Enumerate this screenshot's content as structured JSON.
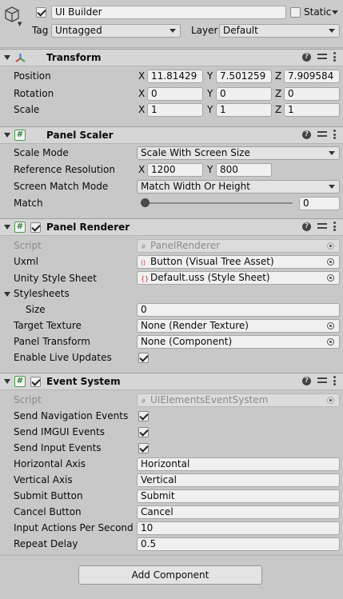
{
  "header": {
    "name": "UI Builder",
    "static_label": "Static",
    "tag_label": "Tag",
    "tag_value": "Untagged",
    "layer_label": "Layer",
    "layer_value": "Default"
  },
  "transform": {
    "title": "Transform",
    "position": {
      "label": "Position",
      "x": "11.81429",
      "y": "7.501259",
      "z": "7.909584"
    },
    "rotation": {
      "label": "Rotation",
      "x": "0",
      "y": "0",
      "z": "0"
    },
    "scale": {
      "label": "Scale",
      "x": "1",
      "y": "1",
      "z": "1"
    },
    "axis": {
      "x": "X",
      "y": "Y",
      "z": "Z"
    }
  },
  "panel_scaler": {
    "title": "Panel Scaler",
    "scale_mode": {
      "label": "Scale Mode",
      "value": "Scale With Screen Size"
    },
    "reference_resolution": {
      "label": "Reference Resolution",
      "x": "1200",
      "y": "800"
    },
    "screen_match_mode": {
      "label": "Screen Match Mode",
      "value": "Match Width Or Height"
    },
    "match": {
      "label": "Match",
      "value": "0",
      "fraction": 0.0
    }
  },
  "panel_renderer": {
    "title": "Panel Renderer",
    "script": {
      "label": "Script",
      "value": "PanelRenderer"
    },
    "uxml": {
      "label": "Uxml",
      "value": "Button (Visual Tree Asset)"
    },
    "style_sheet": {
      "label": "Unity Style Sheet",
      "value": "Default.uss (Style Sheet)"
    },
    "stylesheets_label": "Stylesheets",
    "size": {
      "label": "Size",
      "value": "0"
    },
    "target_texture": {
      "label": "Target Texture",
      "value": "None (Render Texture)"
    },
    "panel_transform": {
      "label": "Panel Transform",
      "value": "None (Component)"
    },
    "live_updates": {
      "label": "Enable Live Updates",
      "checked": true
    }
  },
  "event_system": {
    "title": "Event System",
    "script": {
      "label": "Script",
      "value": "UIElementsEventSystem"
    },
    "nav_events": {
      "label": "Send Navigation Events",
      "checked": true
    },
    "imgui_events": {
      "label": "Send IMGUI Events",
      "checked": true
    },
    "input_events": {
      "label": "Send Input Events",
      "checked": true
    },
    "horizontal_axis": {
      "label": "Horizontal Axis",
      "value": "Horizontal"
    },
    "vertical_axis": {
      "label": "Vertical Axis",
      "value": "Vertical"
    },
    "submit_button": {
      "label": "Submit Button",
      "value": "Submit"
    },
    "cancel_button": {
      "label": "Cancel Button",
      "value": "Cancel"
    },
    "actions_per_second": {
      "label": "Input Actions Per Second",
      "value": "10"
    },
    "repeat_delay": {
      "label": "Repeat Delay",
      "value": "0.5"
    }
  },
  "footer": {
    "add_component": "Add Component"
  },
  "colors": {
    "background": "#c8c8c8",
    "field": "#f0f0f0",
    "script_icon": "#2e7d32"
  }
}
